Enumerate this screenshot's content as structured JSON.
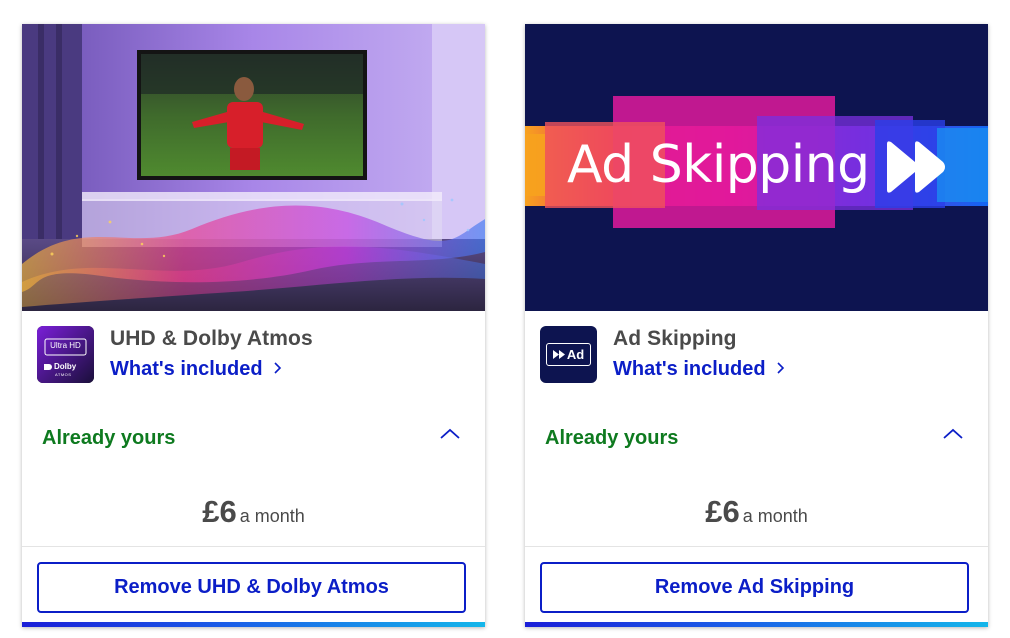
{
  "cards": [
    {
      "title": "UHD & Dolby Atmos",
      "link_label": "What's included",
      "status": "Already yours",
      "price_amount": "£6",
      "price_period": "a month",
      "button_label": "Remove UHD & Dolby Atmos",
      "tile_line1": "Ultra HD",
      "tile_line2": "Dolby",
      "tile_line3": "ATMOS",
      "hero_icon": "tv-living-room-image"
    },
    {
      "title": "Ad Skipping",
      "link_label": "What's included",
      "status": "Already yours",
      "price_amount": "£6",
      "price_period": "a month",
      "button_label": "Remove Ad Skipping",
      "tile_text": "Ad",
      "hero_text": "Ad Skipping",
      "hero_icon": "ad-skipping-banner"
    }
  ],
  "colors": {
    "link": "#0b1ec7",
    "status_green": "#0e7a1f",
    "text_dark": "#4a4a4a",
    "hero2_bg": "#0d1450"
  },
  "icons": [
    "chevron-right-icon",
    "chevron-up-icon",
    "fast-forward-icon",
    "dolby-icon"
  ]
}
